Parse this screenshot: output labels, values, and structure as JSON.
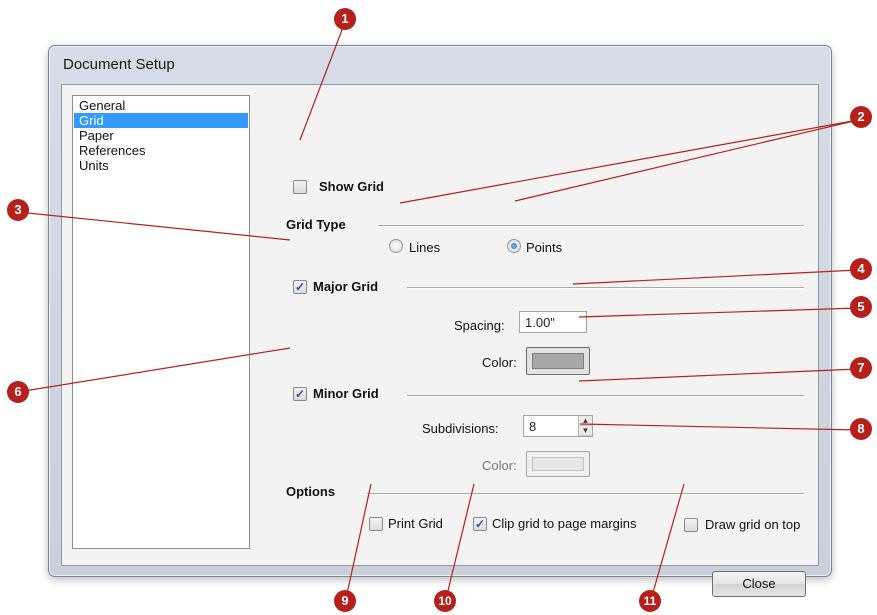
{
  "window": {
    "title": "Document Setup"
  },
  "nav": {
    "items": [
      "General",
      "Grid",
      "Paper",
      "References",
      "Units"
    ],
    "selected": "Grid"
  },
  "grid": {
    "show_grid_label": "Show Grid",
    "show_grid_checked": false,
    "grid_type_label": "Grid Type",
    "lines_label": "Lines",
    "points_label": "Points",
    "grid_type_selected": "Points",
    "major_grid_label": "Major Grid",
    "major_grid_checked": true,
    "spacing_label": "Spacing:",
    "spacing_value": "1.00\"",
    "major_color_label": "Color:",
    "minor_grid_label": "Minor Grid",
    "minor_grid_checked": true,
    "subdivisions_label": "Subdivisions:",
    "subdivisions_value": "8",
    "minor_color_label": "Color:",
    "options_label": "Options",
    "print_grid_label": "Print Grid",
    "print_grid_checked": false,
    "clip_label": "Clip grid to page margins",
    "clip_checked": true,
    "draw_on_top_label": "Draw grid on top",
    "draw_on_top_checked": false
  },
  "buttons": {
    "close_label": "Close"
  },
  "colors": {
    "callout": "#b7201a",
    "major_color": "#a8a8a8",
    "minor_color": "#e6e6e6",
    "selection": "#3399ff"
  },
  "callouts": [
    "1",
    "2",
    "3",
    "4",
    "5",
    "6",
    "7",
    "8",
    "9",
    "10",
    "11"
  ]
}
